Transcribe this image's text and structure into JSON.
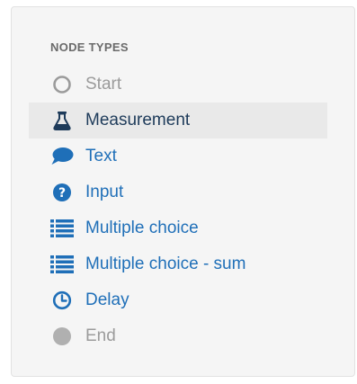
{
  "panel": {
    "heading": "NODE TYPES",
    "items": [
      {
        "label": "Start",
        "icon": "circle-outline-icon",
        "color": "#9b9b9b"
      },
      {
        "label": "Measurement",
        "icon": "flask-icon",
        "color": "#1e3b5a"
      },
      {
        "label": "Text",
        "icon": "speech-bubble-icon",
        "color": "#1f6fb8"
      },
      {
        "label": "Input",
        "icon": "question-circle-icon",
        "color": "#1f6fb8"
      },
      {
        "label": "Multiple choice",
        "icon": "list-icon",
        "color": "#1f6fb8"
      },
      {
        "label": "Multiple choice - sum",
        "icon": "list-icon",
        "color": "#1f6fb8"
      },
      {
        "label": "Delay",
        "icon": "clock-icon",
        "color": "#1f6fb8"
      },
      {
        "label": "End",
        "icon": "filled-circle-icon",
        "color": "#b0b0b0"
      }
    ]
  }
}
